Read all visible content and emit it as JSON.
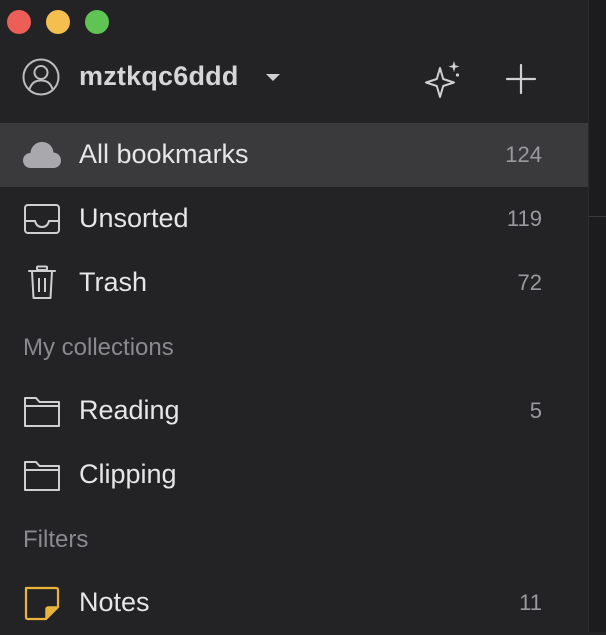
{
  "window": {
    "controls": [
      "close",
      "minimize",
      "zoom"
    ]
  },
  "header": {
    "username": "mztkqc6ddd",
    "icons": [
      "user-avatar-icon",
      "chevron-down-icon",
      "sparkle-icon",
      "plus-icon"
    ]
  },
  "nav": [
    {
      "label": "All bookmarks",
      "count": "124",
      "icon": "cloud-icon",
      "active": true
    },
    {
      "label": "Unsorted",
      "count": "119",
      "icon": "inbox-icon",
      "active": false
    },
    {
      "label": "Trash",
      "count": "72",
      "icon": "trash-icon",
      "active": false
    }
  ],
  "collections": {
    "heading": "My collections",
    "items": [
      {
        "label": "Reading",
        "count": "5",
        "icon": "folder-icon"
      },
      {
        "label": "Clipping",
        "count": "",
        "icon": "folder-icon"
      }
    ]
  },
  "filters": {
    "heading": "Filters",
    "items": [
      {
        "label": "Notes",
        "count": "11",
        "icon": "note-icon"
      }
    ]
  },
  "colors": {
    "background": "#232325",
    "active_row": "#3a3a3c",
    "text": "#e6e6e8",
    "muted": "#8a8a8e",
    "note_accent": "#e8b53a"
  }
}
